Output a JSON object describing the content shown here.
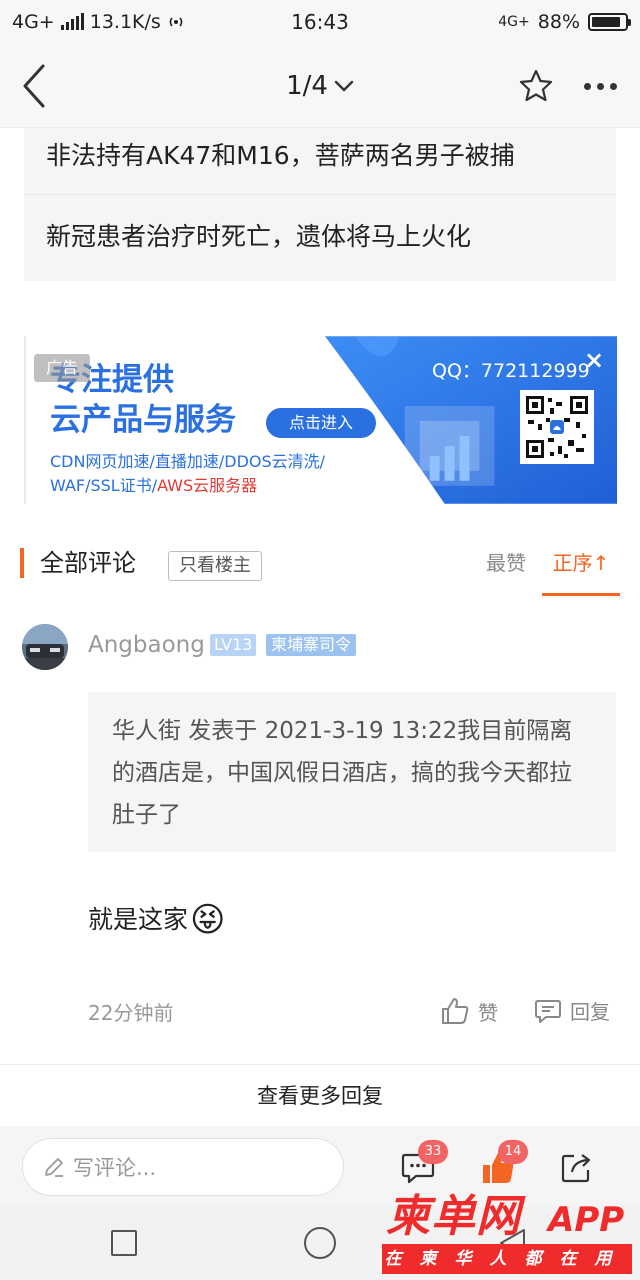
{
  "status_bar": {
    "network": "4G+",
    "speed": "13.1K/s",
    "time": "16:43",
    "network_right": "4G+",
    "battery": "88%",
    "battery_level": 0.88
  },
  "nav": {
    "page_indicator": "1/4"
  },
  "related_news": [
    "非法持有AK47和M16，菩萨两名男子被捕",
    "新冠患者治疗时死亡，遗体将马上火化"
  ],
  "ad": {
    "tag": "广告",
    "headline_line1": "专注提供",
    "headline_line2": "云产品与服务",
    "cta": "点击进入",
    "sub_line1": "CDN网页加速/直播加速/DDOS云清洗/",
    "sub_line2_a": "WAF/SSL证书/",
    "sub_line2_b": "AWS云服务器",
    "qq": "QQ：772112999",
    "close": "×"
  },
  "comments_header": {
    "title": "全部评论",
    "owner_only": "只看楼主",
    "hot": "最赞",
    "order": "正序↑"
  },
  "comment": {
    "username": "Angbaong",
    "level": "LV13",
    "badge": "柬埔寨司令",
    "quote": "华人街 发表于 2021-3-19 13:22我目前隔离的酒店是，中国风假日酒店，搞的我今天都拉肚子了",
    "text": "就是这家",
    "emoji": "😝",
    "time": "22分钟前",
    "like_label": "赞",
    "reply_label": "回复"
  },
  "more_replies": "查看更多回复",
  "bottom_bar": {
    "input_placeholder": "写评论...",
    "comment_count": "33",
    "like_count": "14"
  },
  "watermark": {
    "main": "柬单网",
    "app": "APP",
    "slogan": "在柬华人都在用"
  },
  "colors": {
    "accent": "#f26522",
    "ad_blue": "#2a70e0",
    "badge_red": "#f26363",
    "watermark_red": "#ef2b2b"
  }
}
